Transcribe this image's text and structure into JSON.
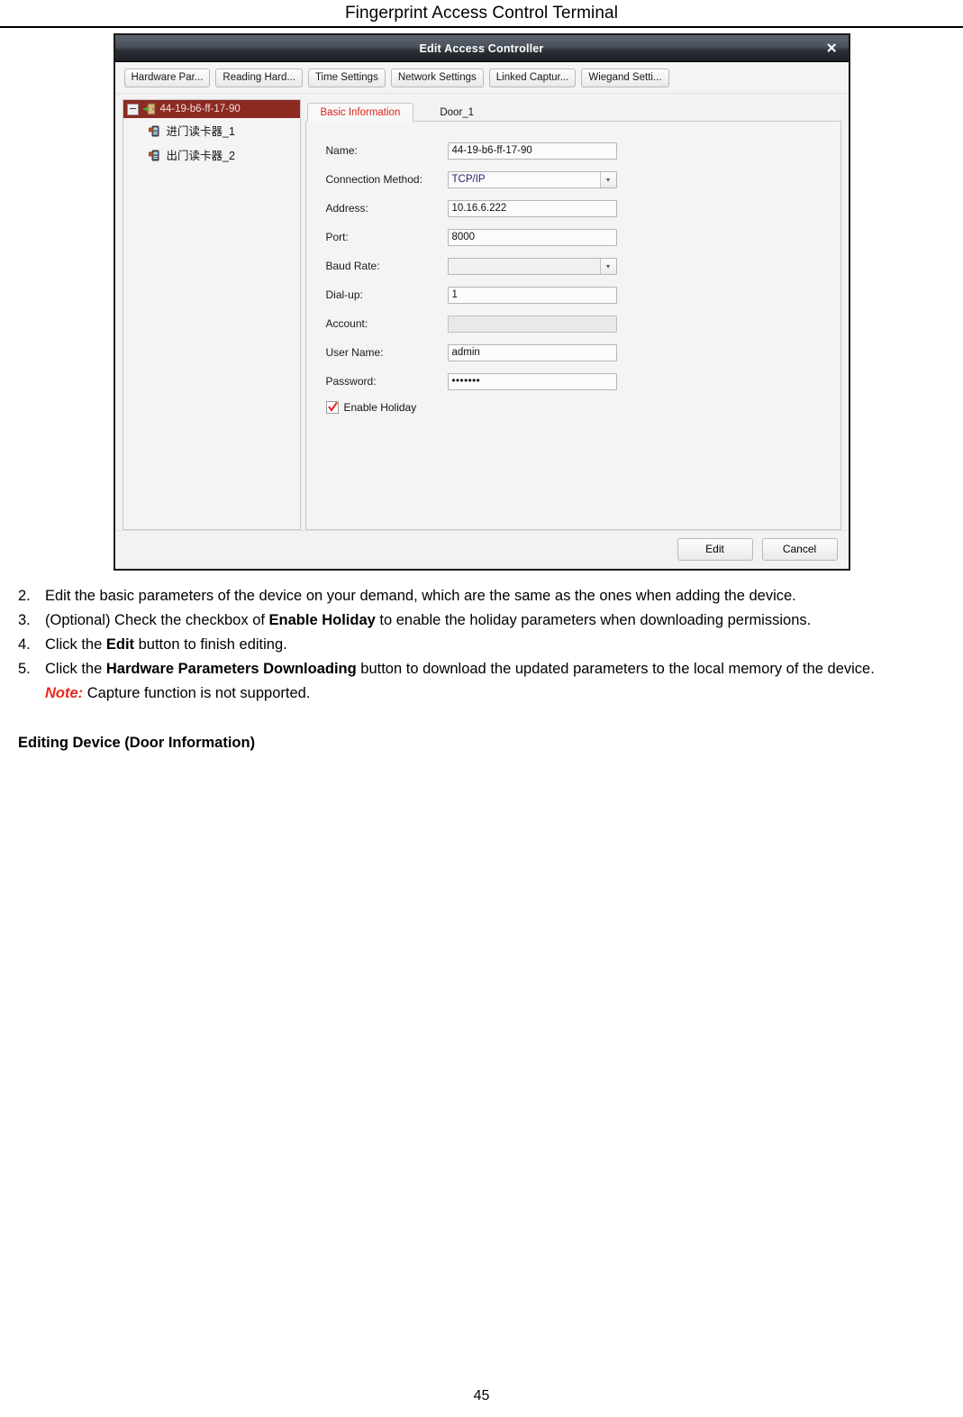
{
  "page": {
    "header_title": "Fingerprint Access Control Terminal",
    "page_number": "45"
  },
  "dialog": {
    "title": "Edit Access Controller",
    "close_icon": "close-icon",
    "toolbar": [
      {
        "label": "Hardware Par..."
      },
      {
        "label": "Reading Hard..."
      },
      {
        "label": "Time Settings"
      },
      {
        "label": "Network Settings"
      },
      {
        "label": "Linked Captur..."
      },
      {
        "label": "Wiegand Setti..."
      }
    ],
    "tree": {
      "root": {
        "label": "44-19-b6-ff-17-90",
        "icon": "door-icon",
        "expander": "collapse-icon"
      },
      "children": [
        {
          "label": "进门读卡器_1",
          "icon": "card-reader-icon"
        },
        {
          "label": "出门读卡器_2",
          "icon": "card-reader-icon"
        }
      ]
    },
    "tabs": [
      {
        "label": "Basic Information",
        "active": true
      },
      {
        "label": "Door_1",
        "active": false
      }
    ],
    "form": {
      "name": {
        "label": "Name:",
        "value": "44-19-b6-ff-17-90"
      },
      "connection_method": {
        "label": "Connection Method:",
        "value": "TCP/IP"
      },
      "address": {
        "label": "Address:",
        "value": "10.16.6.222"
      },
      "port": {
        "label": "Port:",
        "value": "8000"
      },
      "baud_rate": {
        "label": "Baud Rate:",
        "value": ""
      },
      "dial_up": {
        "label": "Dial-up:",
        "value": "1"
      },
      "account": {
        "label": "Account:",
        "value": ""
      },
      "user_name": {
        "label": "User Name:",
        "value": "admin"
      },
      "password": {
        "label": "Password:",
        "value": "•••••••"
      },
      "enable_holiday": {
        "label": "Enable Holiday",
        "checked": true
      }
    },
    "footer": {
      "edit_label": "Edit",
      "cancel_label": "Cancel"
    },
    "colors": {
      "tree_selection": "#8c2a22",
      "active_tab_text": "#e2231a",
      "checkbox_check": "#e2231a",
      "combo_value_text": "#1f1f6b"
    }
  },
  "instructions": {
    "steps": [
      {
        "number": "2.",
        "text_before": "Edit the basic parameters of the device on your demand, which are the same as the ones when adding the device.",
        "bold": "",
        "text_after": ""
      },
      {
        "number": "3.",
        "text_before": "(Optional) Check the checkbox of ",
        "bold": "Enable Holiday",
        "text_after": " to enable the holiday parameters when downloading permissions."
      },
      {
        "number": "4.",
        "text_before": "Click the ",
        "bold": "Edit",
        "text_after": " button to finish editing."
      },
      {
        "number": "5.",
        "text_before": "Click the ",
        "bold": "Hardware Parameters Downloading",
        "text_after": " button to download the updated parameters to the local memory of the device."
      }
    ],
    "note": {
      "label": "Note:",
      "text": " Capture function is not supported."
    },
    "section_heading": "Editing Device (Door Information)"
  }
}
